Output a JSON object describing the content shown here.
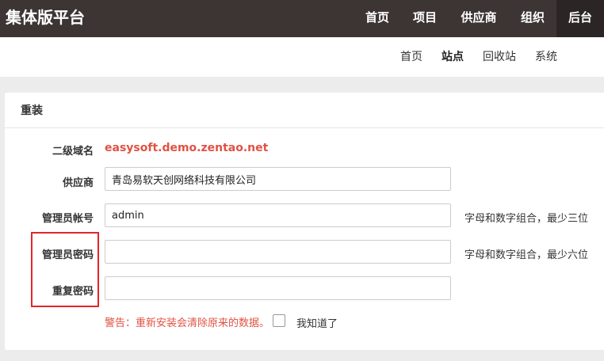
{
  "app": {
    "brand": "集体版平台"
  },
  "topnav": {
    "items": [
      {
        "label": "首页"
      },
      {
        "label": "项目"
      },
      {
        "label": "供应商"
      },
      {
        "label": "组织"
      },
      {
        "label": "后台"
      }
    ],
    "active_index": 4
  },
  "subnav": {
    "items": [
      {
        "label": "首页"
      },
      {
        "label": "站点"
      },
      {
        "label": "回收站"
      },
      {
        "label": "系统"
      }
    ],
    "active_index": 1
  },
  "panel": {
    "title": "重装"
  },
  "form": {
    "domain": {
      "label": "二级域名",
      "value": "easysoft.demo.zentao.net"
    },
    "company": {
      "label": "供应商",
      "value": "青岛易软天创网络科技有限公司"
    },
    "account": {
      "label": "管理员帐号",
      "value": "admin",
      "hint": "字母和数字组合，最少三位"
    },
    "password": {
      "label": "管理员密码",
      "value": "",
      "hint": "字母和数字组合，最少六位"
    },
    "password2": {
      "label": "重复密码",
      "value": ""
    },
    "warning": "警告：重新安装会清除原来的数据。",
    "confirm_label": "我知道了"
  },
  "colors": {
    "topbar": "#3c3534",
    "accent": "#e05243",
    "highlight": "#e0262b"
  }
}
